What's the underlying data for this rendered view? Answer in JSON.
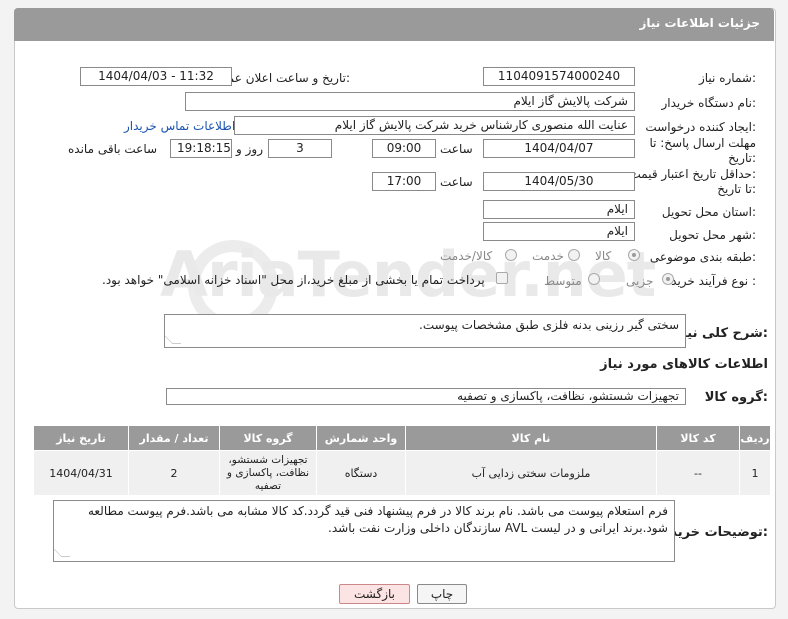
{
  "header": {
    "title": "جزئیات اطلاعات نیاز"
  },
  "fields": {
    "need_number": {
      "label": "شماره نیاز:",
      "value": "1104091574000240"
    },
    "announce_datetime": {
      "label": "تاریخ و ساعت اعلان عمومی:",
      "value": "1404/04/03 - 11:32"
    },
    "buyer_org": {
      "label": "نام دستگاه خریدار:",
      "value": "شرکت پالایش گاز ایلام"
    },
    "requester": {
      "label": "ایجاد کننده درخواست:",
      "value": "عنایت الله منصوری کارشناس خرید شرکت پالایش گاز ایلام",
      "contact_link": "اطلاعات تماس خریدار"
    },
    "reply_deadline": {
      "label_line1": "مهلت ارسال پاسخ: تا",
      "label_line2": "تاریخ:",
      "date": "1404/04/07",
      "time_label": "ساعت",
      "time": "09:00",
      "days": "3",
      "days_label": "روز و",
      "remaining": "19:18:15",
      "remaining_label": "ساعت باقی مانده"
    },
    "price_validity": {
      "label_line1": "حداقل تاریخ اعتبار قیمت:",
      "label_line2": "تا تاریخ:",
      "date": "1404/05/30",
      "time_label": "ساعت",
      "time": "17:00"
    },
    "delivery_province": {
      "label": "استان محل تحویل:",
      "value": "ایلام"
    },
    "delivery_city": {
      "label": "شهر محل تحویل:",
      "value": "ایلام"
    },
    "subject_class": {
      "label": "طبقه بندی موضوعی:",
      "options": [
        "کالا",
        "خدمت",
        "کالا/خدمت"
      ],
      "selected": "کالا"
    },
    "purchase_type": {
      "label": "نوع فرآیند خرید :",
      "options": [
        "جزیی",
        "متوسط"
      ],
      "selected": "جزیی",
      "payment_note": "پرداخت تمام یا بخشی از مبلغ خرید،از محل \"اسناد خزانه اسلامی\" خواهد بود."
    }
  },
  "summary": {
    "label": "شرح کلی نیاز:",
    "value": "سختی گیر رزینی بدنه فلزی طبق مشخصات پیوست."
  },
  "goods_section": {
    "title": "اطلاعات کالاهای مورد نیاز"
  },
  "goods_group": {
    "label": "گروه کالا:",
    "value": "تجهیزات شستشو، نظافت، پاکسازی و تصفیه"
  },
  "table": {
    "headers": [
      "ردیف",
      "کد کالا",
      "نام کالا",
      "واحد شمارش",
      "گروه کالا",
      "تعداد / مقدار",
      "تاریخ نیاز"
    ],
    "rows": [
      [
        "1",
        "--",
        "ملزومات سختی زدایی آب",
        "دستگاه",
        "تجهیزات شستشو، نظافت، پاکسازی و تصفیه",
        "2",
        "1404/04/31"
      ]
    ]
  },
  "buyer_notes": {
    "label": "توضیحات خریدار:",
    "value": "فرم استعلام پیوست می باشد. نام برند کالا در فرم پیشنهاد فنی قید گردد.کد کالا مشابه می باشد.فرم پیوست مطالعه شود.برند ایرانی و در لیست AVL سازندگان داخلی وزارت نفت  باشد."
  },
  "buttons": {
    "print": "چاپ",
    "back": "بازگشت"
  },
  "watermark": {
    "text": "AriaTender.net"
  }
}
